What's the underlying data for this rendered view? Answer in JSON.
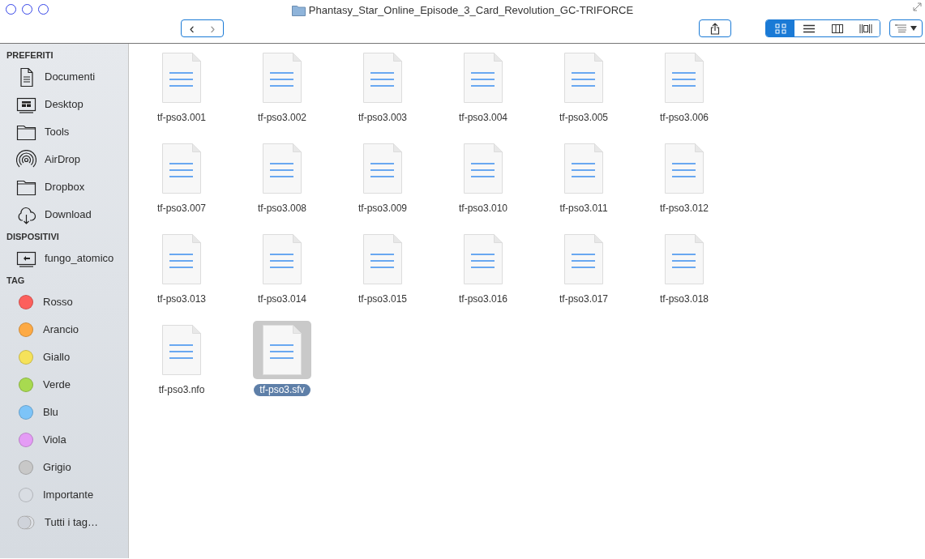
{
  "window": {
    "title": "Phantasy_Star_Online_Episode_3_Card_Revolution_GC-TRIFORCE"
  },
  "toolbar": {
    "back": {
      "label": "‹",
      "disabled": false
    },
    "forward": {
      "label": "›",
      "disabled": true
    },
    "views": [
      {
        "kind": "icons",
        "selected": true
      },
      {
        "kind": "list",
        "selected": false
      },
      {
        "kind": "columns",
        "selected": false
      },
      {
        "kind": "coverflow",
        "selected": false
      }
    ]
  },
  "sidebar": {
    "sections": [
      {
        "title": "PREFERITI",
        "items": [
          {
            "kind": "document",
            "label": "Documenti"
          },
          {
            "kind": "desktop",
            "label": "Desktop"
          },
          {
            "kind": "folder",
            "label": "Tools"
          },
          {
            "kind": "airdrop",
            "label": "AirDrop"
          },
          {
            "kind": "folder",
            "label": "Dropbox"
          },
          {
            "kind": "download",
            "label": "Download"
          }
        ]
      },
      {
        "title": "DISPOSITIVI",
        "items": [
          {
            "kind": "computer",
            "label": "fungo_atomico"
          }
        ]
      },
      {
        "title": "TAG",
        "items": [
          {
            "kind": "tag",
            "label": "Rosso",
            "color": "#fc605c"
          },
          {
            "kind": "tag",
            "label": "Arancio",
            "color": "#fdaa45"
          },
          {
            "kind": "tag",
            "label": "Giallo",
            "color": "#f5e25a"
          },
          {
            "kind": "tag",
            "label": "Verde",
            "color": "#a8da50"
          },
          {
            "kind": "tag",
            "label": "Blu",
            "color": "#7dc4f8"
          },
          {
            "kind": "tag",
            "label": "Viola",
            "color": "#e49cf5"
          },
          {
            "kind": "tag",
            "label": "Grigio",
            "color": "#c8c8c8"
          },
          {
            "kind": "tag",
            "label": "Importante",
            "color": "#d9dde3"
          },
          {
            "kind": "all-tags",
            "label": "Tutti i tag…"
          }
        ]
      }
    ]
  },
  "files": [
    {
      "name": "tf-pso3.001",
      "selected": false
    },
    {
      "name": "tf-pso3.002",
      "selected": false
    },
    {
      "name": "tf-pso3.003",
      "selected": false
    },
    {
      "name": "tf-pso3.004",
      "selected": false
    },
    {
      "name": "tf-pso3.005",
      "selected": false
    },
    {
      "name": "tf-pso3.006",
      "selected": false
    },
    {
      "name": "tf-pso3.007",
      "selected": false
    },
    {
      "name": "tf-pso3.008",
      "selected": false
    },
    {
      "name": "tf-pso3.009",
      "selected": false
    },
    {
      "name": "tf-pso3.010",
      "selected": false
    },
    {
      "name": "tf-pso3.011",
      "selected": false
    },
    {
      "name": "tf-pso3.012",
      "selected": false
    },
    {
      "name": "tf-pso3.013",
      "selected": false
    },
    {
      "name": "tf-pso3.014",
      "selected": false
    },
    {
      "name": "tf-pso3.015",
      "selected": false
    },
    {
      "name": "tf-pso3.016",
      "selected": false
    },
    {
      "name": "tf-pso3.017",
      "selected": false
    },
    {
      "name": "tf-pso3.018",
      "selected": false
    },
    {
      "name": "tf-pso3.nfo",
      "selected": false
    },
    {
      "name": "tf-pso3.sfv",
      "selected": true
    }
  ]
}
